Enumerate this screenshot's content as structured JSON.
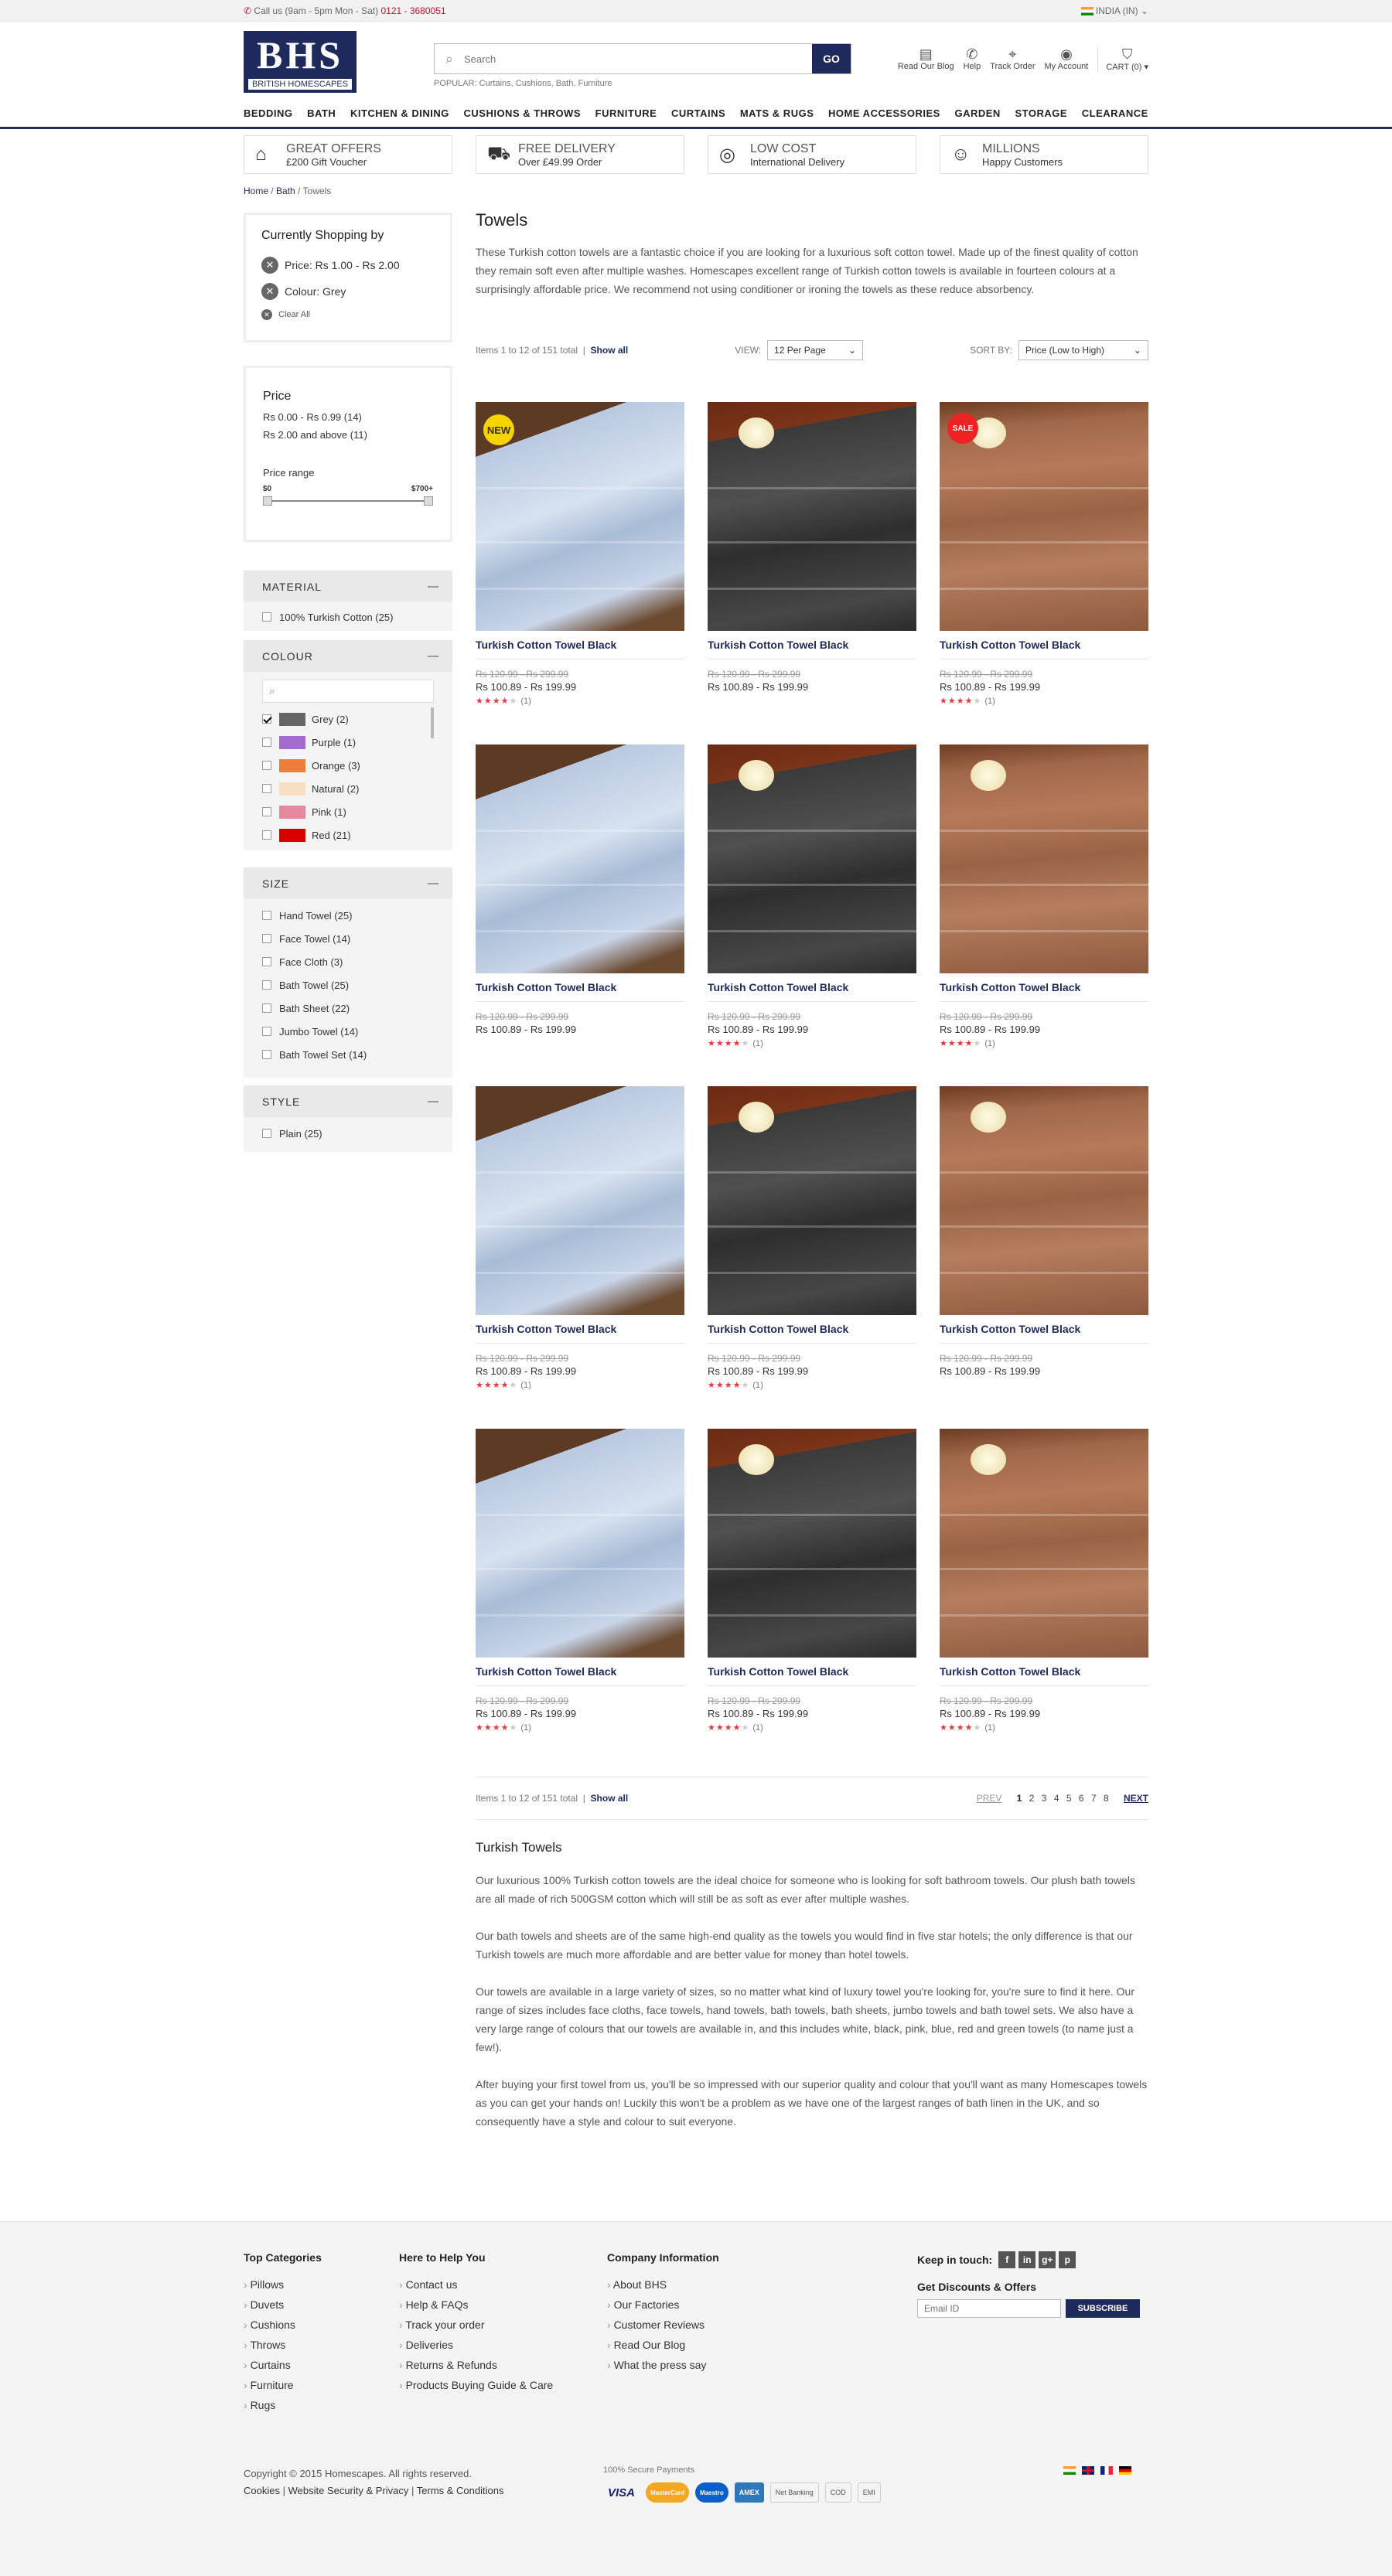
{
  "topbar": {
    "call_label": "Call us (9am - 5pm Mon - Sat)",
    "phone": "0121 - 3680051",
    "country": "INDIA (IN)"
  },
  "header": {
    "logo_text": "BHS",
    "logo_sub": "BRITISH HOMESCAPES",
    "search_placeholder": "Search",
    "go_label": "GO",
    "popular": "POPULAR: Curtains, Cushions, Bath, Furniture",
    "links": [
      {
        "icon": "newspaper-icon",
        "label": "Read Our Blog"
      },
      {
        "icon": "phone-icon",
        "label": "Help"
      },
      {
        "icon": "map-pin-icon",
        "label": "Track Order"
      },
      {
        "icon": "user-icon",
        "label": "My Account"
      },
      {
        "icon": "cart-icon",
        "label": "CART (0)"
      }
    ]
  },
  "nav": [
    "BEDDING",
    "BATH",
    "KITCHEN & DINING",
    "CUSHIONS & THROWS",
    "FURNITURE",
    "CURTAINS",
    "MATS & RUGS",
    "HOME ACCESSORIES",
    "GARDEN",
    "STORAGE",
    "CLEARANCE"
  ],
  "usp": [
    {
      "icon": "gift-icon",
      "title": "GREAT OFFERS",
      "sub": "£200 Gift Voucher"
    },
    {
      "icon": "truck-icon",
      "title": "FREE DELIVERY",
      "sub": "Over £49.99 Order"
    },
    {
      "icon": "globe-icon",
      "title": "LOW COST",
      "sub": "International Delivery"
    },
    {
      "icon": "smiley-icon",
      "title": "MILLIONS",
      "sub": "Happy Customers"
    }
  ],
  "breadcrumb": [
    "Home",
    "Bath",
    "Towels"
  ],
  "current_shopping": {
    "title": "Currently Shopping by",
    "filters": [
      "Price: Rs 1.00 - Rs 2.00",
      "Colour: Grey"
    ],
    "clear": "Clear All"
  },
  "price": {
    "title": "Price",
    "options": [
      "Rs 0.00 - Rs 0.99 (14)",
      "Rs 2.00 and above (11)"
    ],
    "range_label": "Price range",
    "min": "$0",
    "max": "$700+"
  },
  "material": {
    "title": "MATERIAL",
    "options": [
      "100% Turkish Cotton (25)"
    ]
  },
  "colour": {
    "title": "COLOUR",
    "options": [
      {
        "label": "Grey (2)",
        "color": "#666666",
        "checked": true
      },
      {
        "label": "Purple (1)",
        "color": "#a46bd1",
        "checked": false
      },
      {
        "label": "Orange (3)",
        "color": "#ee7d3a",
        "checked": false
      },
      {
        "label": "Natural (2)",
        "color": "#f7dfc4",
        "checked": false
      },
      {
        "label": "Pink (1)",
        "color": "#e58a9e",
        "checked": false
      },
      {
        "label": "Red (21)",
        "color": "#d90000",
        "checked": false
      }
    ]
  },
  "size": {
    "title": "SIZE",
    "options": [
      "Hand Towel (25)",
      "Face Towel (14)",
      "Face Cloth (3)",
      "Bath Towel (25)",
      "Bath Sheet (22)",
      "Jumbo Towel (14)",
      "Bath Towel Set (14)"
    ]
  },
  "style": {
    "title": "STYLE",
    "options": [
      "Plain (25)"
    ]
  },
  "main": {
    "title": "Towels",
    "description": "These Turkish cotton towels are a fantastic choice if you are looking for a luxurious soft cotton towel. Made up of the finest quality of cotton they remain soft even after multiple washes. Homescapes excellent range of Turkish cotton towels is available in fourteen colours at a surprisingly affordable price. We recommend not using conditioner or ironing the towels as these reduce absorbency.",
    "items_text": "Items 1 to 12 of 151 total",
    "show_all": "Show all",
    "view_label": "VIEW:",
    "view_value": "12 Per Page",
    "sort_label": "SORT BY:",
    "sort_value": "Price (Low to High)"
  },
  "products": [
    {
      "name": "Turkish Cotton Towel Black",
      "old": "Rs 120.99 - Rs 299.99",
      "price": "Rs 100.89 - Rs 199.99",
      "rating": 4,
      "reviews": "(1)",
      "variant": "blue",
      "badge": "NEW"
    },
    {
      "name": "Turkish Cotton Towel Black",
      "old": "Rs 120.99 - Rs 299.99",
      "price": "Rs 100.89 - Rs 199.99",
      "rating": 0,
      "reviews": "",
      "variant": "black",
      "badge": ""
    },
    {
      "name": "Turkish Cotton Towel Black",
      "old": "Rs 120.99 - Rs 299.99",
      "price": "Rs 100.89 - Rs 199.99",
      "rating": 4,
      "reviews": "(1)",
      "variant": "brown",
      "badge": "SALE"
    },
    {
      "name": "Turkish Cotton Towel Black",
      "old": "Rs 120.99 - Rs 299.99",
      "price": "Rs 100.89 - Rs 199.99",
      "rating": 0,
      "reviews": "",
      "variant": "blue",
      "badge": ""
    },
    {
      "name": "Turkish Cotton Towel Black",
      "old": "Rs 120.99 - Rs 299.99",
      "price": "Rs 100.89 - Rs 199.99",
      "rating": 4,
      "reviews": "(1)",
      "variant": "black",
      "badge": ""
    },
    {
      "name": "Turkish Cotton Towel Black",
      "old": "Rs 120.99 - Rs 299.99",
      "price": "Rs 100.89 - Rs 199.99",
      "rating": 4,
      "reviews": "(1)",
      "variant": "brown",
      "badge": ""
    },
    {
      "name": "Turkish Cotton Towel Black",
      "old": "Rs 120.99 - Rs 299.99",
      "price": "Rs 100.89 - Rs 199.99",
      "rating": 4,
      "reviews": "(1)",
      "variant": "blue",
      "badge": ""
    },
    {
      "name": "Turkish Cotton Towel Black",
      "old": "Rs 120.99 - Rs 299.99",
      "price": "Rs 100.89 - Rs 199.99",
      "rating": 4,
      "reviews": "(1)",
      "variant": "black",
      "badge": ""
    },
    {
      "name": "Turkish Cotton Towel Black",
      "old": "Rs 120.99 - Rs 299.99",
      "price": "Rs 100.89 - Rs 199.99",
      "rating": 0,
      "reviews": "",
      "variant": "brown",
      "badge": ""
    },
    {
      "name": "Turkish Cotton Towel Black",
      "old": "Rs 120.99 - Rs 299.99",
      "price": "Rs 100.89 - Rs 199.99",
      "rating": 4,
      "reviews": "(1)",
      "variant": "blue",
      "badge": ""
    },
    {
      "name": "Turkish Cotton Towel Black",
      "old": "Rs 120.99 - Rs 299.99",
      "price": "Rs 100.89 - Rs 199.99",
      "rating": 4,
      "reviews": "(1)",
      "variant": "black",
      "badge": ""
    },
    {
      "name": "Turkish Cotton Towel Black",
      "old": "Rs 120.99 - Rs 299.99",
      "price": "Rs 100.89 - Rs 199.99",
      "rating": 4,
      "reviews": "(1)",
      "variant": "brown",
      "badge": ""
    }
  ],
  "pager": {
    "prev": "PREV",
    "pages": [
      "1",
      "2",
      "3",
      "4",
      "5",
      "6",
      "7",
      "8"
    ],
    "current": "1",
    "next": "NEXT"
  },
  "seo": {
    "title": "Turkish Towels",
    "paragraphs": [
      "Our luxurious 100% Turkish cotton towels are the ideal choice for someone who is looking for soft bathroom towels. Our plush bath towels are all made of rich 500GSM cotton which will still be as soft as ever after multiple washes.",
      "Our bath towels and sheets are of the same high-end quality as the towels you would find in five star hotels; the only difference is that our Turkish towels are much more affordable and are better value for money than hotel towels.",
      "Our towels are available in a large variety of sizes, so no matter what kind of luxury towel you're looking for, you're sure to find it here. Our range of sizes includes face cloths, face towels, hand towels, bath towels, bath sheets, jumbo towels and bath towel sets. We also have a very large range of colours that our towels are available in, and this includes white, black, pink, blue, red and green towels (to name just a few!).",
      "After buying your first towel from us, you'll be so impressed with our superior quality and colour that you'll want as many Homescapes towels as you can get your hands on! Luckily this won't be a problem as we have one of the largest ranges of bath linen in the UK, and so consequently have a style and colour to suit everyone."
    ]
  },
  "footer": {
    "top_categories": {
      "title": "Top Categories",
      "items": [
        "Pillows",
        "Duvets",
        "Cushions",
        "Throws",
        "Curtains",
        "Furniture",
        "Rugs"
      ]
    },
    "help": {
      "title": "Here to Help You",
      "items": [
        "Contact us",
        "Help & FAQs",
        "Track your order",
        "Deliveries",
        "Returns & Refunds",
        "Products Buying Guide & Care"
      ]
    },
    "company": {
      "title": "Company Information",
      "items": [
        "About BHS",
        "Our Factories",
        "Customer Reviews",
        "Read Our Blog",
        "What the press say"
      ]
    },
    "keep_in_touch": "Keep in touch:",
    "social": [
      "f",
      "in",
      "g+",
      "p"
    ],
    "discounts_title": "Get Discounts & Offers",
    "email_placeholder": "Email ID",
    "subscribe": "SUBSCRIBE",
    "copyright": "Copyright © 2015 Homescapes. All rights reserved.",
    "legal": [
      "Cookies",
      "Website Security & Privacy",
      "Terms & Conditions"
    ],
    "payments_title": "100% Secure Payments",
    "payments": [
      "VISA",
      "MasterCard",
      "Maestro",
      "AMEX",
      "Net Banking",
      "COD",
      "EMI"
    ]
  }
}
